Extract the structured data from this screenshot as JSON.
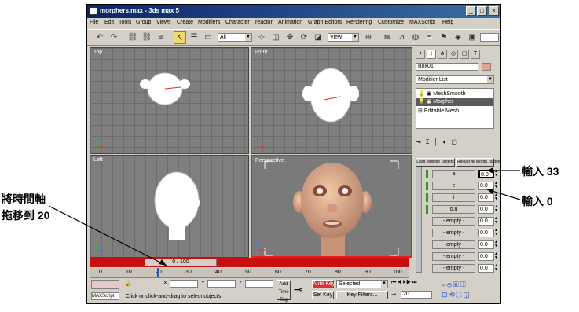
{
  "window": {
    "title": "morphers.max - 3ds max 5",
    "min": "_",
    "max": "□",
    "close": "×"
  },
  "menu": [
    "File",
    "Edit",
    "Tools",
    "Group",
    "Views",
    "Create",
    "Modifiers",
    "Character",
    "reactor",
    "Animation",
    "Graph Editors",
    "Rendering",
    "Customize",
    "MAXScript",
    "Help"
  ],
  "toolbar": {
    "selection_filter": "All",
    "coord_system": "View"
  },
  "viewports": {
    "top": "Top",
    "front": "Front",
    "left": "Left",
    "perspective": "Perspective"
  },
  "panel": {
    "object_name": "Box01",
    "modifier_list": "Modifier List",
    "stack": [
      "MeshSmooth",
      "Morpher",
      "Editable Mesh"
    ],
    "load_btn": "Load Multiple Targets",
    "reload_btn": "Reload All Morph Targets",
    "channels": [
      {
        "name": "a",
        "value": "0.0"
      },
      {
        "name": "e",
        "value": "0.0"
      },
      {
        "name": "i",
        "value": "0.0"
      },
      {
        "name": "o,u",
        "value": "0.0"
      },
      {
        "name": "- empty -",
        "value": "0.0"
      },
      {
        "name": "- empty -",
        "value": "0.0"
      },
      {
        "name": "- empty -",
        "value": "0.0"
      },
      {
        "name": "- empty -",
        "value": "0.0"
      },
      {
        "name": "- empty -",
        "value": "0.0"
      },
      {
        "name": "- empty -",
        "value": "0.0"
      }
    ]
  },
  "timeline": {
    "slider": "0 / 100",
    "ticks": [
      "0",
      "10",
      "20",
      "30",
      "40",
      "50",
      "60",
      "70",
      "80",
      "90",
      "100"
    ]
  },
  "status": {
    "x_label": "X",
    "y_label": "Y",
    "z_label": "Z",
    "prompt": "Click or click-and-drag to select objects",
    "add_time": "Add Time Tag",
    "auto_key": "Auto Key",
    "set_key": "Set Key",
    "selected": "Selected",
    "key_filters": "Key Filters...",
    "frame": "20",
    "maxscript": "MAXScript"
  },
  "annotations": {
    "drag": "將時間軸\n拖移到 20",
    "input33": "輸入 33",
    "input0": "輸入 0"
  },
  "colors": {
    "active_vp": "#e81d1d",
    "timeline": "#c81010",
    "auto_key": "#e03030"
  }
}
